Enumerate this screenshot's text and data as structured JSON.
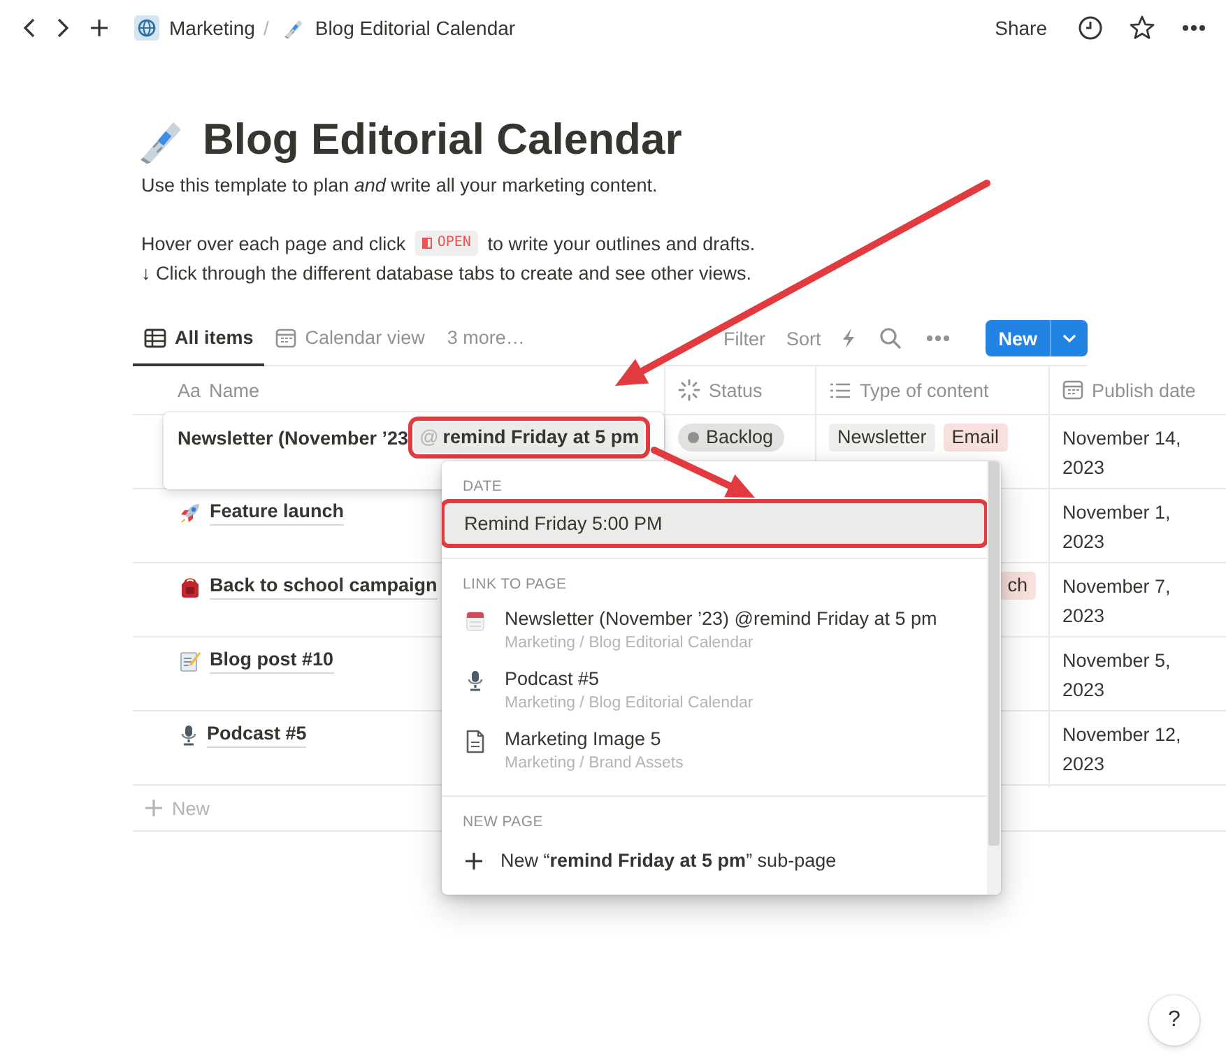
{
  "topbar": {
    "breadcrumb": [
      {
        "label": "Marketing"
      },
      {
        "label": "Blog Editorial Calendar"
      }
    ],
    "separator": "/",
    "share": "Share"
  },
  "page": {
    "title": "Blog Editorial Calendar",
    "intro": "Use this template to plan *and* write all your marketing content.",
    "hint_before": "Hover over each page and click",
    "open_badge": "OPEN",
    "hint_after": "to write your outlines and drafts.",
    "tabs_hint": "↓ Click through the different database tabs to create and see other views."
  },
  "views": {
    "tabs": [
      {
        "label": "All items",
        "kind": "table",
        "selected": true
      },
      {
        "label": "Calendar view",
        "kind": "calendar",
        "selected": false
      },
      {
        "label": "3 more…",
        "kind": "more",
        "selected": false
      }
    ],
    "actions": [
      "Filter",
      "Sort"
    ],
    "new_button": "New"
  },
  "table": {
    "columns": [
      {
        "kind": "title",
        "prefix": "Aa",
        "label": "Name"
      },
      {
        "kind": "status",
        "label": "Status"
      },
      {
        "kind": "multi",
        "label": "Type of content"
      },
      {
        "kind": "date",
        "label": "Publish date"
      }
    ],
    "rows": [
      {
        "status": "Backlog",
        "types": [
          {
            "label": "Newsletter",
            "color": "#efefed"
          },
          {
            "label": "Email",
            "color": "#f8e1dc"
          }
        ],
        "date": "November 14, 2023"
      },
      {
        "kind": "rocket",
        "name": "Feature launch",
        "date": "November 1, 2023"
      },
      {
        "kind": "backpack",
        "name": "Back to school campaign",
        "types": [
          {
            "label": "ch",
            "color": "#f8e1dc",
            "cut": true
          }
        ],
        "date": "November 7, 2023"
      },
      {
        "kind": "memo",
        "name": "Blog post #10",
        "date": "November 5, 2023"
      },
      {
        "kind": "microphone",
        "name": "Podcast #5",
        "date": "November 12, 2023"
      }
    ],
    "new_row": "New"
  },
  "editor": {
    "text": "Newsletter (November ’23",
    "mention_symbol": "@",
    "mention": "remind Friday at 5 pm",
    "highlighted": true
  },
  "popup": {
    "sections": [
      {
        "kind": "date",
        "heading": "DATE",
        "items": [
          {
            "title": "Remind Friday 5:00 PM",
            "highlighted": true
          }
        ]
      },
      {
        "kind": "links",
        "heading": "LINK TO PAGE",
        "items": [
          {
            "title": "Newsletter (November ’23) @remind Friday at 5 pm",
            "path": "Marketing / Blog Editorial Calendar",
            "kind": "calendar"
          },
          {
            "title": "Podcast #5",
            "path": "Marketing / Blog Editorial Calendar",
            "kind": "microphone"
          },
          {
            "title": "Marketing Image 5",
            "path": "Marketing / Brand Assets",
            "kind": "page"
          }
        ]
      },
      {
        "kind": "new",
        "heading": "NEW PAGE",
        "items": [
          {
            "title": "New “**remind Friday at 5 pm**” sub-page"
          }
        ]
      }
    ]
  },
  "help": "?"
}
